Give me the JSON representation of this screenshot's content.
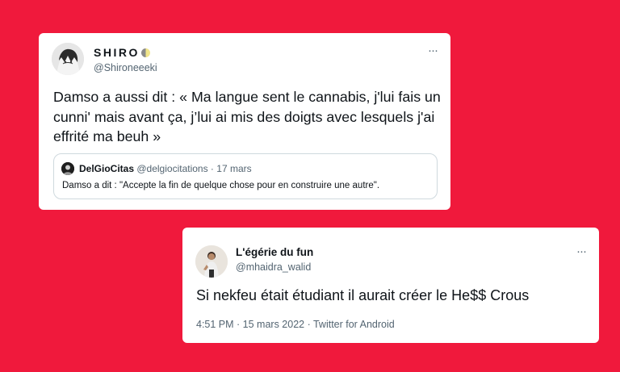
{
  "tweet1": {
    "display_name": "SHIRO",
    "handle": "@Shironeeeki",
    "more": "···",
    "text": "Damso a aussi dit : « Ma langue sent le cannabis, j'lui fais un cunni' mais avant ça, j’lui ai mis des doigts avec lesquels j'ai effrité ma beuh »",
    "quote": {
      "display_name": "DelGioCitas",
      "handle": "@delgiocitations",
      "separator": " · ",
      "date": "17 mars",
      "text": "Damso a dit : \"Accepte la fin de quelque chose pour en construire une autre\"."
    }
  },
  "tweet2": {
    "display_name": "L'égérie du fun",
    "handle": "@mhaidra_walid",
    "more": "···",
    "text": "Si nekfeu était étudiant il aurait créer le He$$ Crous",
    "meta": "4:51 PM · 15 mars 2022 · Twitter for Android"
  },
  "colors": {
    "background": "#f0193c",
    "card": "#ffffff",
    "text": "#0f1419",
    "secondary_text": "#536471",
    "quote_border": "#cfd9de"
  },
  "icons": {
    "tweet1_name_emoji": "moon-icon",
    "more": "more-icon"
  }
}
